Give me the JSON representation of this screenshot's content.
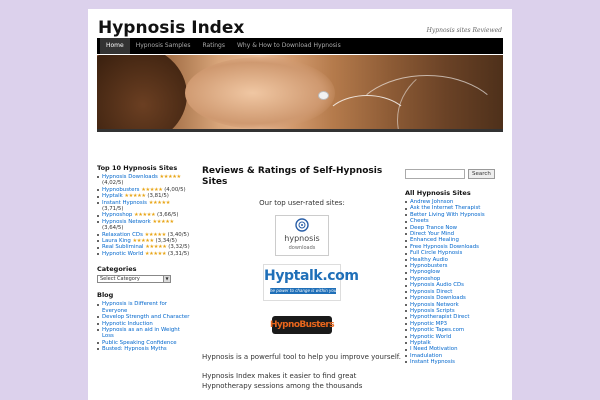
{
  "site": {
    "title": "Hypnosis Index",
    "tagline": "Hypnosis sites Reviewed"
  },
  "nav": [
    {
      "label": "Home",
      "active": true
    },
    {
      "label": "Hypnosis Samples",
      "active": false
    },
    {
      "label": "Ratings",
      "active": false
    },
    {
      "label": "Why & How to Download Hypnosis",
      "active": false
    }
  ],
  "left": {
    "top10_title": "Top 10 Hypnosis Sites",
    "top10": [
      {
        "name": "Hypnosis Downloads",
        "rating": "(4,02/5)",
        "stars": 4
      },
      {
        "name": "Hypnobusters",
        "rating": "(4,00/5)",
        "stars": 4
      },
      {
        "name": "Hyptalk",
        "rating": "(3,81/5)",
        "stars": 4
      },
      {
        "name": "Instant Hypnosis",
        "rating": "(3,71/5)",
        "stars": 4
      },
      {
        "name": "Hypnoshop",
        "rating": "(3,66/5)",
        "stars": 4
      },
      {
        "name": "Hypnosis Network",
        "rating": "(3,64/5)",
        "stars": 4
      },
      {
        "name": "Relaxation CDs",
        "rating": "(3,40/5)",
        "stars": 3
      },
      {
        "name": "Laura King",
        "rating": "(3,34/5)",
        "stars": 3
      },
      {
        "name": "Real Subliminal",
        "rating": "(3,32/5)",
        "stars": 3
      },
      {
        "name": "Hypnotic World",
        "rating": "(3,31/5)",
        "stars": 3
      }
    ],
    "categories_title": "Categories",
    "categories_select": "Select Category",
    "blog_title": "Blog",
    "blog": [
      "Hypnosis is Different for Everyone",
      "Develop Strength and Character",
      "Hypnotic Induction",
      "Hypnosis as an aid in Weight Loss",
      "Public Speaking Confidence",
      "Busted: Hypnosis Myths"
    ]
  },
  "main": {
    "heading": "Reviews & Ratings of Self-Hypnosis Sites",
    "intro": "Our top user-rated sites:",
    "logos": {
      "hd_line1": "hypnosis",
      "hd_line2": "downloads",
      "hyptalk": "Hyptalk.com",
      "hyptalk_sub": "The power to change is within you",
      "hb": "HypnoBusters"
    },
    "p1": "Hypnosis is a powerful tool to help you improve yourself.",
    "p2": "Hypnosis Index makes it easier to find great Hypnotherapy sessions among the thousands"
  },
  "right": {
    "search_button": "Search",
    "all_title": "All Hypnosis Sites",
    "all": [
      "Andrew Johnson",
      "Ask the Internet Therapist",
      "Better Living With Hypnosis",
      "Cheets",
      "Deep Trance Now",
      "Direct Your Mind",
      "Enhanced Healing",
      "Free Hypnosis Downloads",
      "Full Circle Hypnosis",
      "Healthy Audio",
      "Hypnobusters",
      "Hypnoglow",
      "Hypnoshop",
      "Hypnosis Audio CDs",
      "Hypnosis Direct",
      "Hypnosis Downloads",
      "Hypnosis Network",
      "Hypnosis Scripts",
      "Hypnotherapist Direct",
      "Hypnotic MP3",
      "Hypnotic Tapes.com",
      "Hypnotic World",
      "Hyptalk",
      "I Need Motivation",
      "Imadulation",
      "Instant Hypnosis"
    ]
  },
  "colors": {
    "link": "#0066cc",
    "nav_bg": "#000000",
    "page_bg": "#dcd1ec",
    "star": "#e8a517"
  }
}
